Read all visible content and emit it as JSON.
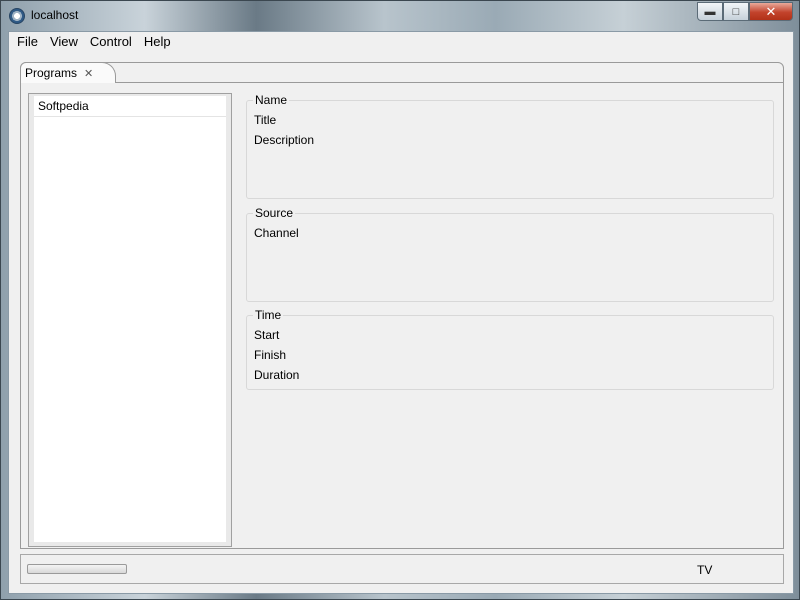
{
  "window": {
    "title": "localhost"
  },
  "menu": [
    "File",
    "View",
    "Control",
    "Help"
  ],
  "tab": {
    "label": "Programs"
  },
  "list": {
    "items": [
      "Softpedia"
    ]
  },
  "groups": {
    "name": {
      "title": "Name",
      "fields": [
        "Title",
        "Description"
      ]
    },
    "source": {
      "title": "Source",
      "fields": [
        "Channel"
      ]
    },
    "time": {
      "title": "Time",
      "fields": [
        "Start",
        "Finish",
        "Duration"
      ]
    }
  },
  "status": {
    "mode": "TV"
  },
  "icons": {
    "app": "app-globe-icon",
    "minimize": "minimize-icon",
    "maximize": "maximize-icon",
    "close": "close-icon",
    "tab_close": "close-tab-icon"
  }
}
